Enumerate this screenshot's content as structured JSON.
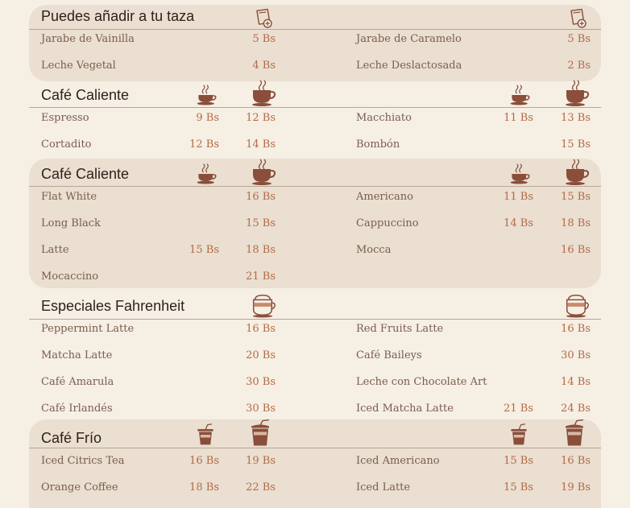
{
  "colors": {
    "background": "#f6efe4",
    "shaded": "#eadfd1",
    "price": "#b46a45",
    "icon": "#8a4e3a",
    "title": "#2f211b"
  },
  "addons": {
    "title": "Puedes añadir a tu taza",
    "icon": "cup-add-icon",
    "left": [
      {
        "name": "Jarabe de Vainilla",
        "price": "5 Bs"
      },
      {
        "name": "Leche Vegetal",
        "price": "4 Bs"
      }
    ],
    "right": [
      {
        "name": "Jarabe de Caramelo",
        "price": "5 Bs"
      },
      {
        "name": "Leche Deslactosada",
        "price": "2 Bs"
      }
    ]
  },
  "hot1": {
    "title": "Café Caliente",
    "icons": [
      "small-hot-cup-icon",
      "large-hot-cup-icon"
    ],
    "left": [
      {
        "name": "Espresso",
        "small": "9 Bs",
        "large": "12 Bs"
      },
      {
        "name": "Cortadito",
        "small": "12 Bs",
        "large": "14 Bs"
      }
    ],
    "right": [
      {
        "name": "Macchiato",
        "small": "11 Bs",
        "large": "13 Bs"
      },
      {
        "name": "Bombón",
        "small": "",
        "large": "15 Bs"
      }
    ]
  },
  "hot2": {
    "title": "Café Caliente",
    "icons": [
      "small-hot-cup-icon",
      "large-hot-cup-icon"
    ],
    "left": [
      {
        "name": "Flat White",
        "small": "",
        "large": "16 Bs"
      },
      {
        "name": "Long Black",
        "small": "",
        "large": "15 Bs"
      },
      {
        "name": "Latte",
        "small": "15 Bs",
        "large": "18 Bs"
      },
      {
        "name": "Mocaccino",
        "small": "",
        "large": "21 Bs"
      }
    ],
    "right": [
      {
        "name": "Americano",
        "small": "11 Bs",
        "large": "15 Bs"
      },
      {
        "name": "Cappuccino",
        "small": "14 Bs",
        "large": "18 Bs"
      },
      {
        "name": "Mocca",
        "small": "",
        "large": "16 Bs"
      }
    ]
  },
  "specials": {
    "title": "Especiales Fahrenheit",
    "icon": "layered-cup-icon",
    "left": [
      {
        "name": "Peppermint Latte",
        "small": "",
        "large": "16 Bs"
      },
      {
        "name": "Matcha Latte",
        "small": "",
        "large": "20 Bs"
      },
      {
        "name": "Café Amarula",
        "small": "",
        "large": "30 Bs"
      },
      {
        "name": "Café Irlandés",
        "small": "",
        "large": "30 Bs"
      }
    ],
    "right": [
      {
        "name": "Red Fruits Latte",
        "small": "",
        "large": "16 Bs"
      },
      {
        "name": "Café Baileys",
        "small": "",
        "large": "30 Bs"
      },
      {
        "name": "Leche con Chocolate Art",
        "small": "",
        "large": "14 Bs"
      },
      {
        "name": "Iced Matcha Latte",
        "small": "21 Bs",
        "large": "24 Bs"
      }
    ]
  },
  "cold": {
    "title": "Café Frío",
    "icons": [
      "small-iced-cup-icon",
      "large-iced-cup-icon"
    ],
    "left": [
      {
        "name": "Iced Citrics Tea",
        "small": "16 Bs",
        "large": "19 Bs"
      },
      {
        "name": "Orange Coffee",
        "small": "18 Bs",
        "large": "22 Bs"
      }
    ],
    "right": [
      {
        "name": "Iced Americano",
        "small": "15 Bs",
        "large": "16 Bs"
      },
      {
        "name": "Iced Latte",
        "small": "15 Bs",
        "large": "19 Bs"
      }
    ]
  }
}
